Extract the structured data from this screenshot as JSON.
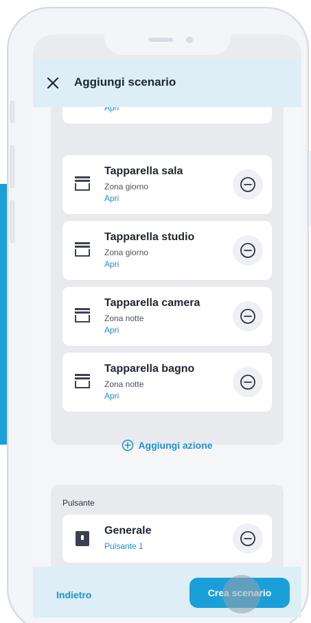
{
  "header": {
    "title": "Aggiungi scenario"
  },
  "actions": {
    "partial_item": {
      "action": "Apri"
    },
    "items": [
      {
        "title": "Tapparella sala",
        "zone": "Zona giorno",
        "action": "Apri"
      },
      {
        "title": "Tapparella studio",
        "zone": "Zona giorno",
        "action": "Apri"
      },
      {
        "title": "Tapparella camera",
        "zone": "Zona notte",
        "action": "Apri"
      },
      {
        "title": "Tapparella bagno",
        "zone": "Zona notte",
        "action": "Apri"
      }
    ],
    "add_label": "Aggiungi azione"
  },
  "button_section": {
    "label": "Pulsante",
    "item": {
      "title": "Generale",
      "subtitle": "Pulsante 1"
    }
  },
  "footer": {
    "back_label": "Indietro",
    "create_label": "Crea scenario"
  },
  "icons": {
    "close": "close-icon",
    "shutter": "shutter-icon",
    "remove": "minus-circle-icon",
    "add": "plus-circle-icon",
    "button": "wall-button-icon"
  },
  "colors": {
    "accent": "#1b9fd8",
    "link": "#1b8fd0",
    "header_bg": "#ddeef6",
    "group_bg": "#e8eaed"
  }
}
